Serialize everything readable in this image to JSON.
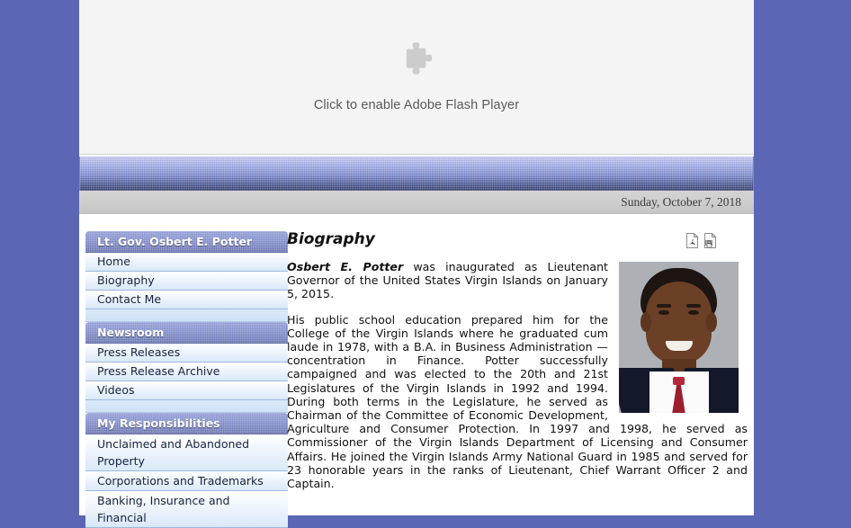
{
  "flash": {
    "icon": "puzzle-piece-icon",
    "label": "Click to enable Adobe Flash Player"
  },
  "date_bar": {
    "date": "Sunday, October 7, 2018"
  },
  "sidebar": {
    "sections": [
      {
        "header": "Lt. Gov. Osbert E. Potter",
        "items": [
          {
            "label": "Home",
            "active": false
          },
          {
            "label": "Biography",
            "active": false
          },
          {
            "label": "Contact Me",
            "active": false
          }
        ]
      },
      {
        "header": "Newsroom",
        "items": [
          {
            "label": "Press Releases",
            "active": false
          },
          {
            "label": "Press Release Archive",
            "active": false
          },
          {
            "label": "Videos",
            "active": false
          }
        ]
      },
      {
        "header": "My Responsibilities",
        "items": [
          {
            "label": "Unclaimed and Abandoned Property",
            "active": false
          },
          {
            "label": "Corporations and Trademarks",
            "active": false
          },
          {
            "label": "Banking, Insurance and Financial",
            "active": false
          }
        ]
      }
    ]
  },
  "content": {
    "title": "Biography",
    "actions": [
      {
        "name": "pdf-icon",
        "label": "PDF"
      },
      {
        "name": "print-preview-icon",
        "label": "Print"
      }
    ],
    "portrait_alt": "Osbert E. Potter portrait",
    "paragraphs": [
      {
        "lead": "Osbert E. Potter",
        "text": " was inaugurated as Lieutenant Governor of the United States Virgin Islands on January 5, 2015."
      },
      {
        "lead": "",
        "text": "His public school education prepared him for the College of the Virgin Islands where he graduated cum laude in 1978, with a B.A. in Business Administration — concentration in Finance.  Potter successfully campaigned and was elected to the 20th and 21st Legislatures of the Virgin Islands in 1992 and 1994. During both terms in the Legislature, he served as Chairman of the Committee of Economic Development, Agriculture and Consumer Protection. In 1997 and 1998, he served as Commissioner of the Virgin Islands Department of Licensing and Consumer Affairs.  He joined the Virgin Islands Army National Guard in 1985 and served for 23 honorable years in the ranks of Lieutenant, Chief Warrant Officer 2 and Captain."
      }
    ]
  },
  "colors": {
    "page_background": "#5b66b4",
    "nav_header_gradient_top": "#8f9ad4",
    "nav_header_gradient_bottom": "#6672ad",
    "nav_item_background": "#e8f1fb",
    "banner_dark": "#232c5e",
    "text": "#111111"
  }
}
